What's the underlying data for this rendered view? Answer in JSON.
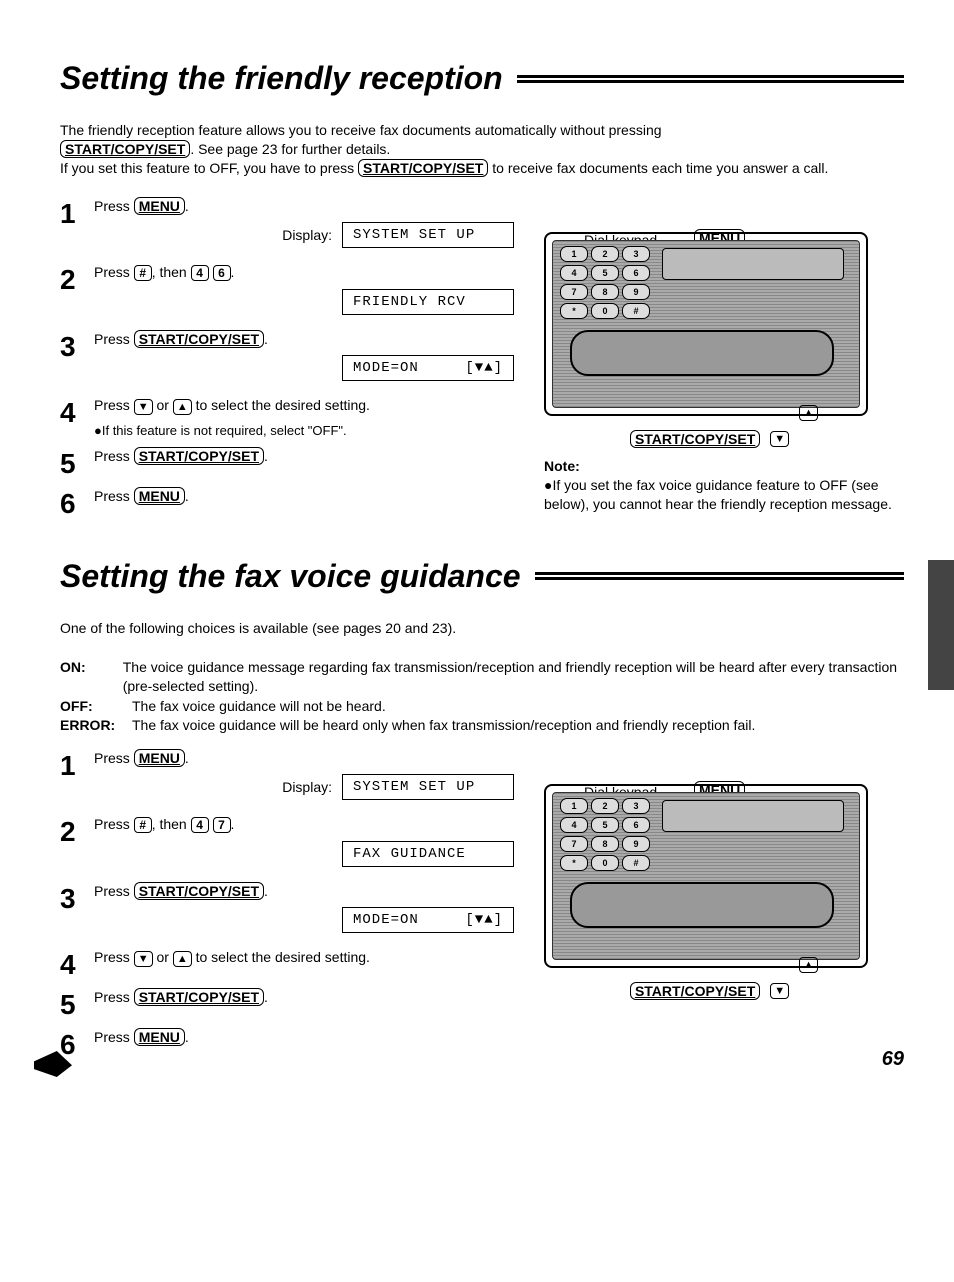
{
  "section1": {
    "title": "Setting the friendly reception",
    "intro_line1": "The friendly reception feature allows you to receive fax documents automatically without pressing",
    "intro_line2a": ". See page 23 for further details.",
    "intro_line3a": "If you set this feature to OFF, you have to press ",
    "intro_line3b": " to receive fax documents each time you answer a call.",
    "step1": "Press ",
    "display_label": "Display:",
    "lcd1": "SYSTEM SET UP",
    "step2a": "Press ",
    "step2b": ", then ",
    "key_hash": "#",
    "key_4": "4",
    "key_6": "6",
    "lcd2": "FRIENDLY RCV",
    "step3": "Press ",
    "lcd3_left": "MODE=ON",
    "lcd3_right": "[▼▲]",
    "step4a": "Press ",
    "step4b": " or ",
    "step4c": " to select the desired setting.",
    "step4_note": "●If this feature is not required, select \"OFF\".",
    "step5": "Press ",
    "step6": "Press ",
    "dial_keypad_label": "Dial keypad",
    "start_copy_set": "START/COPY/SET",
    "menu": "MENU",
    "note_title": "Note:",
    "note_body": "●If you set the fax voice guidance feature to OFF (see below), you cannot hear the friendly reception message."
  },
  "section2": {
    "title": "Setting the fax voice guidance",
    "intro": "One of the following choices is available (see pages 20 and 23).",
    "on_k": "ON:",
    "on_v": "The voice guidance message regarding fax transmission/reception and friendly reception will be heard after every transaction (pre-selected setting).",
    "off_k": "OFF:",
    "off_v": "The fax voice guidance will not be heard.",
    "err_k": "ERROR:",
    "err_v": "The fax voice guidance will be heard only when fax transmission/reception and friendly reception fail.",
    "step1": "Press ",
    "display_label": "Display:",
    "lcd1": "SYSTEM SET UP",
    "step2a": "Press ",
    "step2b": ", then ",
    "key_4": "4",
    "key_7": "7",
    "lcd2": "FAX GUIDANCE",
    "step3": "Press ",
    "lcd3_left": "MODE=ON",
    "lcd3_right": "[▼▲]",
    "step4a": "Press ",
    "step4b": " or ",
    "step4c": " to select the desired setting.",
    "step5": "Press ",
    "step6": "Press "
  },
  "page_number": "69",
  "arrows": {
    "down": "▼",
    "up": "▲"
  },
  "keypad_keys": [
    "1",
    "2",
    "3",
    "4",
    "5",
    "6",
    "7",
    "8",
    "9",
    "*",
    "0",
    "#"
  ]
}
